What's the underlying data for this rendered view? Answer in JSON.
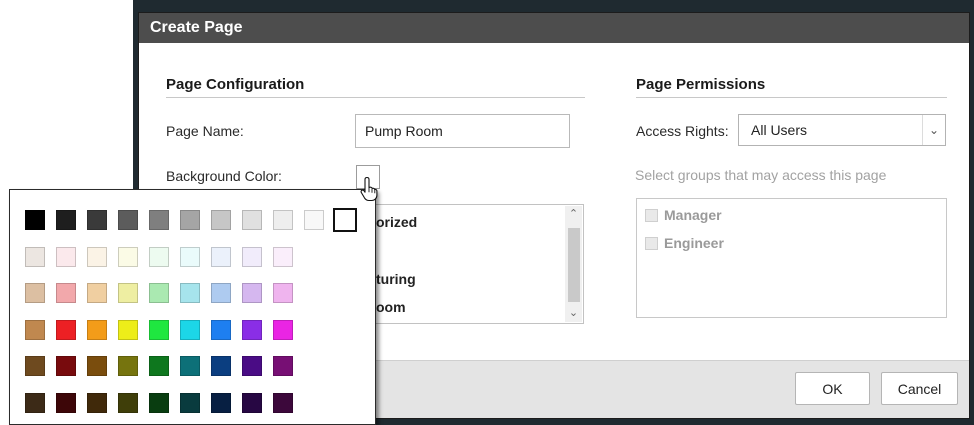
{
  "dialog": {
    "title": "Create Page",
    "config_heading": "Page Configuration",
    "permissions_heading": "Page Permissions",
    "page_name_label": "Page Name:",
    "page_name_value": "Pump Room",
    "background_color_label": "Background Color:",
    "list_items": [
      "Authorized",
      "",
      "Manufacturing",
      "Pump Room"
    ],
    "list_items_visible": [
      "orized",
      "",
      "turing",
      "oom"
    ],
    "access_rights_label": "Access Rights:",
    "access_rights_value": "All Users",
    "groups_hint": "Select groups that may access this page",
    "groups": [
      "Manager",
      "Engineer"
    ],
    "ok_label": "OK",
    "cancel_label": "Cancel"
  },
  "color_picker": {
    "rows": [
      [
        "#000000",
        "#1e1e1e",
        "#3a3a3a",
        "#5c5c5c",
        "#7f7f7f",
        "#a5a5a5",
        "#c6c6c6",
        "#e0e0e0",
        "#eeeeee",
        "#f8f8f8",
        "#ffffff"
      ],
      [
        "#ece6e1",
        "#fbe9ec",
        "#fbf3e6",
        "#fbfbe6",
        "#edfbf0",
        "#eafbfb",
        "#ebf1fb",
        "#f1ecfb",
        "#faeefb"
      ],
      [
        "#dcbfa2",
        "#f2a8ab",
        "#f0cfa1",
        "#eeeea2",
        "#aae9b1",
        "#a6e4ec",
        "#aecbf0",
        "#d5b7ef",
        "#efb4ee"
      ],
      [
        "#c0884f",
        "#ec2024",
        "#f39c19",
        "#eded19",
        "#1fe740",
        "#1cd6e7",
        "#1e7ff0",
        "#8a2ee6",
        "#ea25e4"
      ],
      [
        "#6e4a1f",
        "#780b0d",
        "#7a4d0d",
        "#76740e",
        "#0e771e",
        "#0d7078",
        "#0b3e80",
        "#4a0c85",
        "#770f74"
      ],
      [
        "#3c2a17",
        "#3d0608",
        "#40290a",
        "#3f3e09",
        "#093d10",
        "#093b3e",
        "#071f42",
        "#270743",
        "#3c083b"
      ]
    ],
    "selected_color": "#ffffff"
  }
}
